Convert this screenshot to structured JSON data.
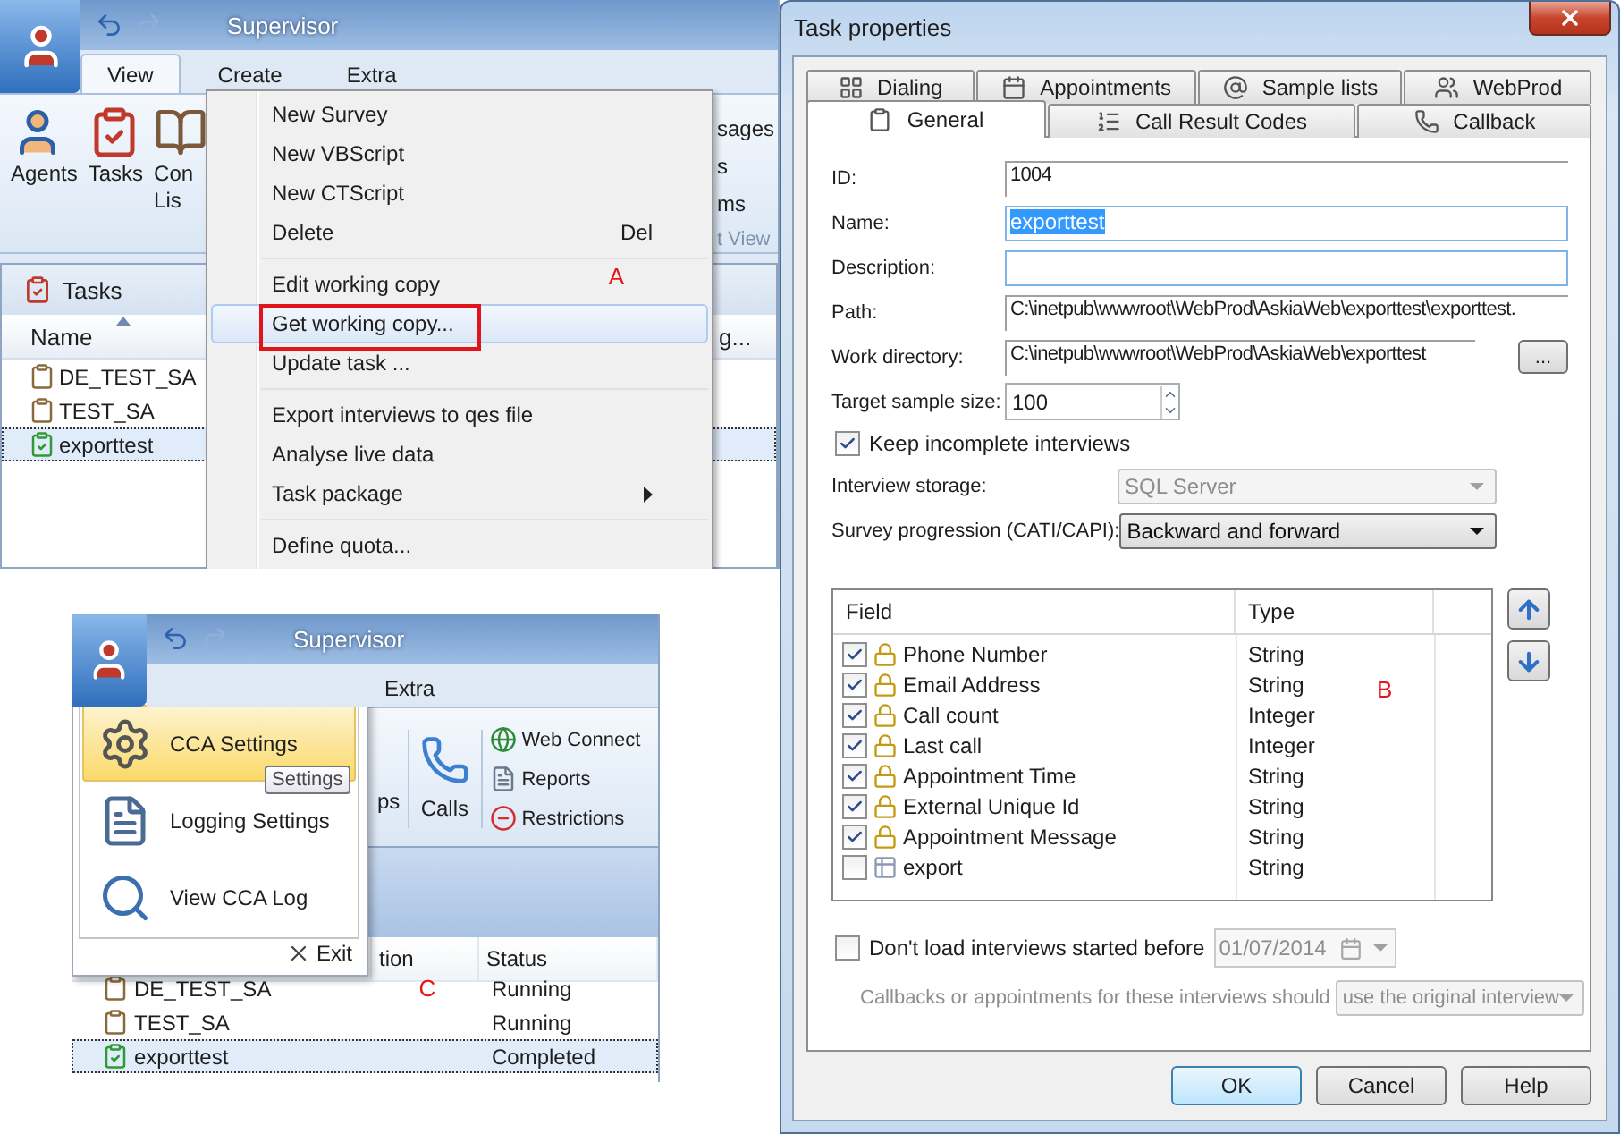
{
  "supervisor_main": {
    "title": "Supervisor",
    "tabs": [
      {
        "label": "View",
        "selected": true
      },
      {
        "label": "Create",
        "selected": false
      },
      {
        "label": "Extra",
        "selected": false
      }
    ],
    "ribbon_buttons": [
      {
        "kind": "agent",
        "lines": [
          "Agents"
        ]
      },
      {
        "kind": "tasks",
        "lines": [
          "Tasks"
        ]
      },
      {
        "kind": "contacts",
        "lines": [
          "Con",
          "Lis"
        ]
      }
    ],
    "ribbon_cut_texts": [
      "sages",
      "s",
      "ms"
    ],
    "ribbon_group_label": "t View",
    "tasks_panel": {
      "title": "Tasks",
      "columns": [
        "Name",
        "g..."
      ],
      "rows": [
        {
          "name": "DE_TEST_SA",
          "kind": "task",
          "selected": false
        },
        {
          "name": "TEST_SA",
          "kind": "task",
          "selected": false
        },
        {
          "name": "exporttest",
          "kind": "done",
          "selected": true
        }
      ]
    },
    "context_menu": {
      "groups": [
        [
          {
            "label": "New Survey",
            "selected": false,
            "boxed": false
          },
          {
            "label": "New VBScript",
            "selected": false,
            "boxed": false
          },
          {
            "label": "New CTScript",
            "selected": false,
            "boxed": false
          },
          {
            "label": "Delete",
            "shortcut": "Del",
            "selected": false,
            "boxed": false
          }
        ],
        [
          {
            "label": "Edit working copy",
            "selected": false,
            "boxed": false
          },
          {
            "label": "Get working copy...",
            "selected": true,
            "boxed": true
          },
          {
            "label": "Update task ...",
            "selected": false,
            "boxed": false
          }
        ],
        [
          {
            "label": "Export interviews to qes file",
            "selected": false,
            "boxed": false
          },
          {
            "label": "Analyse live data",
            "selected": false,
            "boxed": false
          },
          {
            "label": "Task package",
            "submenu": true,
            "selected": false,
            "boxed": false
          }
        ],
        [
          {
            "label": "Define quota...",
            "selected": false,
            "boxed": false
          }
        ]
      ]
    },
    "annotation": "A"
  },
  "supervisor_app_menu": {
    "title": "Supervisor",
    "tab": "Extra",
    "ribbon_cut_text": "ps",
    "calls_button": "Calls",
    "ribbon_links": [
      {
        "kind": "globe",
        "label": "Web Connect"
      },
      {
        "kind": "report",
        "label": "Reports"
      },
      {
        "kind": "stop",
        "label": "Restrictions"
      }
    ],
    "menu_items": [
      {
        "kind": "settings",
        "label": "CCA Settings",
        "selected": true
      },
      {
        "kind": "logging",
        "label": "Logging Settings",
        "selected": false
      },
      {
        "kind": "log",
        "label": "View CCA Log",
        "selected": false
      }
    ],
    "tooltip": "Settings",
    "exit": "Exit",
    "columns": [
      "tion",
      "Status"
    ],
    "rows": [
      {
        "name": "DE_TEST_SA",
        "status": "Running",
        "kind": "task",
        "selected": false
      },
      {
        "name": "TEST_SA",
        "status": "Running",
        "kind": "task",
        "selected": false
      },
      {
        "name": "exporttest",
        "status": "Completed",
        "kind": "done",
        "selected": true
      }
    ],
    "annotation": "C"
  },
  "task_properties": {
    "title": "Task properties",
    "tab_rows": [
      [
        {
          "label": "Dialing",
          "kind": "dialing",
          "selected": false
        },
        {
          "label": "Appointments",
          "kind": "calendar",
          "selected": false
        },
        {
          "label": "Sample lists",
          "kind": "sample",
          "selected": false
        },
        {
          "label": "WebProd",
          "kind": "web",
          "selected": false
        }
      ],
      [
        {
          "label": "General",
          "kind": "general",
          "selected": true
        },
        {
          "label": "Call Result Codes",
          "kind": "codes",
          "selected": false
        },
        {
          "label": "Callback",
          "kind": "callback",
          "selected": false
        }
      ]
    ],
    "fields": [
      {
        "label": "ID:",
        "kind": "readonly",
        "value": "1004"
      },
      {
        "label": "Name:",
        "kind": "input",
        "value": "exporttest",
        "text_selected": true
      },
      {
        "label": "Description:",
        "kind": "input"
      },
      {
        "label": "Path:",
        "kind": "readonly",
        "value": "C:\\inetpub\\wwwroot\\WebProd\\AskiaWeb\\exporttest\\exporttest."
      },
      {
        "label": "Work directory:",
        "kind": "browse",
        "value": "C:\\inetpub\\wwwroot\\WebProd\\AskiaWeb\\exporttest",
        "button": "..."
      },
      {
        "label": "Target sample size:",
        "kind": "spin",
        "value": "100"
      }
    ],
    "keep_incomplete": {
      "label": "Keep incomplete interviews",
      "checked": true
    },
    "selects": [
      {
        "label": "Interview storage:",
        "value": "SQL Server",
        "disabled": true
      },
      {
        "label": "Survey progression (CATI/CAPI):",
        "value": "Backward and forward",
        "disabled": false
      }
    ],
    "field_table": {
      "columns": [
        "Field",
        "Type"
      ],
      "rows": [
        {
          "field": "Phone Number",
          "type": "String",
          "checked": true,
          "locked": true
        },
        {
          "field": "Email Address",
          "type": "String",
          "checked": true,
          "locked": true
        },
        {
          "field": "Call count",
          "type": "Integer",
          "checked": true,
          "locked": true
        },
        {
          "field": "Last call",
          "type": "Integer",
          "checked": true,
          "locked": true
        },
        {
          "field": "Appointment Time",
          "type": "String",
          "checked": true,
          "locked": true
        },
        {
          "field": "External Unique Id",
          "type": "String",
          "checked": true,
          "locked": true
        },
        {
          "field": "Appointment Message",
          "type": "String",
          "checked": true,
          "locked": true
        },
        {
          "field": "export",
          "type": "String",
          "checked": false,
          "locked": false
        }
      ],
      "annotation": "B"
    },
    "date_filter": {
      "label": "Don't load interviews started before",
      "checked": false,
      "date": "01/07/2014",
      "disabled": true
    },
    "callbacks": {
      "label": "Callbacks or appointments for these interviews should",
      "value": "use the original interview",
      "disabled": true
    },
    "buttons": [
      {
        "label": "OK",
        "default": true
      },
      {
        "label": "Cancel",
        "default": false
      },
      {
        "label": "Help",
        "default": false
      }
    ]
  }
}
